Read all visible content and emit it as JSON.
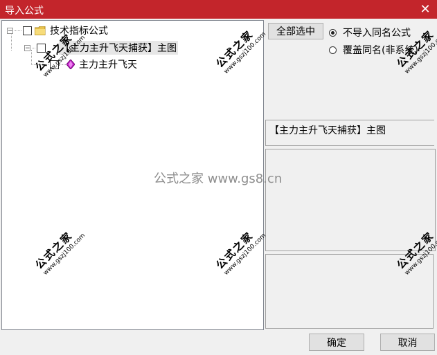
{
  "window": {
    "title": "导入公式",
    "close_glyph": "✕"
  },
  "tree": {
    "root": {
      "label": "技术指标公式",
      "expander": "−"
    },
    "formula": {
      "label": "【主力主升飞天捕获】主图",
      "expander": "−"
    },
    "leaf": {
      "label": "主力主升飞天"
    }
  },
  "options": {
    "select_all_label": "全部选中",
    "radio_skip_label": "不导入同名公式",
    "radio_overwrite_label": "覆盖同名(非系统)",
    "selected": "skip"
  },
  "details": {
    "name": "【主力主升飞天捕获】主图"
  },
  "footer": {
    "ok_label": "确定",
    "cancel_label": "取消"
  },
  "watermark": {
    "center": "公式之家 www.gs8.cn",
    "stamp_line1": "公式之家",
    "stamp_line2": "www.gszj100.com"
  }
}
